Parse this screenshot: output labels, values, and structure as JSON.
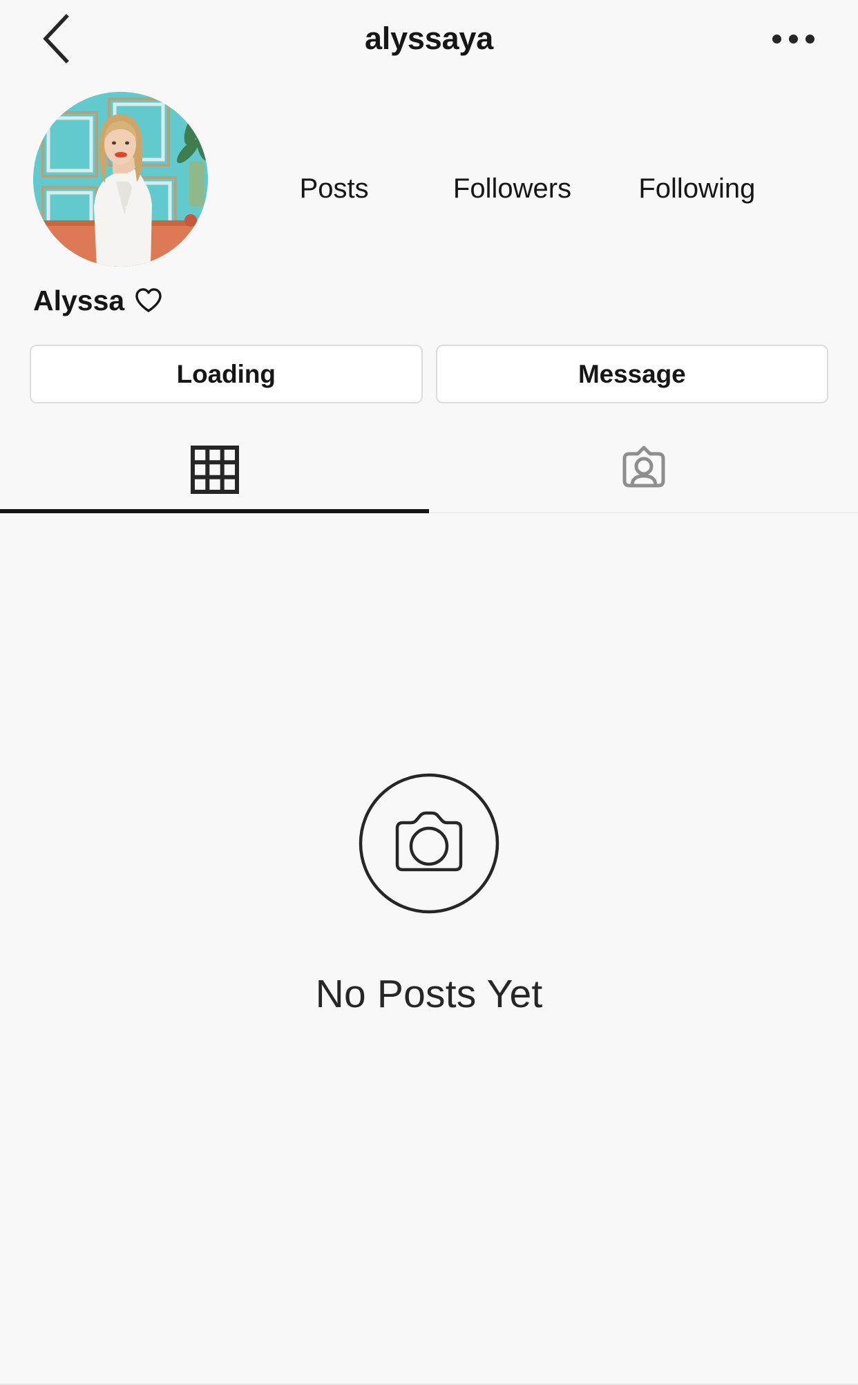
{
  "app": "instagram-profile",
  "colors": {
    "background": "#f8f8f8",
    "text": "#161616",
    "border": "#dcdcdc",
    "inactive_icon": "#8e8e8e",
    "active_indicator": "#161616",
    "divider": "#eeeeee"
  },
  "header": {
    "back_icon": "chevron-left-icon",
    "title": "alyssaya",
    "more_icon": "more-options-icon"
  },
  "profile": {
    "avatar_alt": "woman seated against turquoise paneled door",
    "display_name": "Alyssa",
    "bio_emoji": "heart-outline-icon",
    "stats": [
      {
        "count": "",
        "label": "Posts"
      },
      {
        "count": "",
        "label": "Followers"
      },
      {
        "count": "",
        "label": "Following"
      }
    ]
  },
  "actions": {
    "follow_label": "Loading",
    "message_label": "Message"
  },
  "tabs": [
    {
      "id": "grid",
      "icon": "grid-icon",
      "active": true
    },
    {
      "id": "tagged",
      "icon": "tagged-person-icon",
      "active": false
    }
  ],
  "empty_state": {
    "icon": "camera-circle-icon",
    "title": "No Posts Yet"
  }
}
